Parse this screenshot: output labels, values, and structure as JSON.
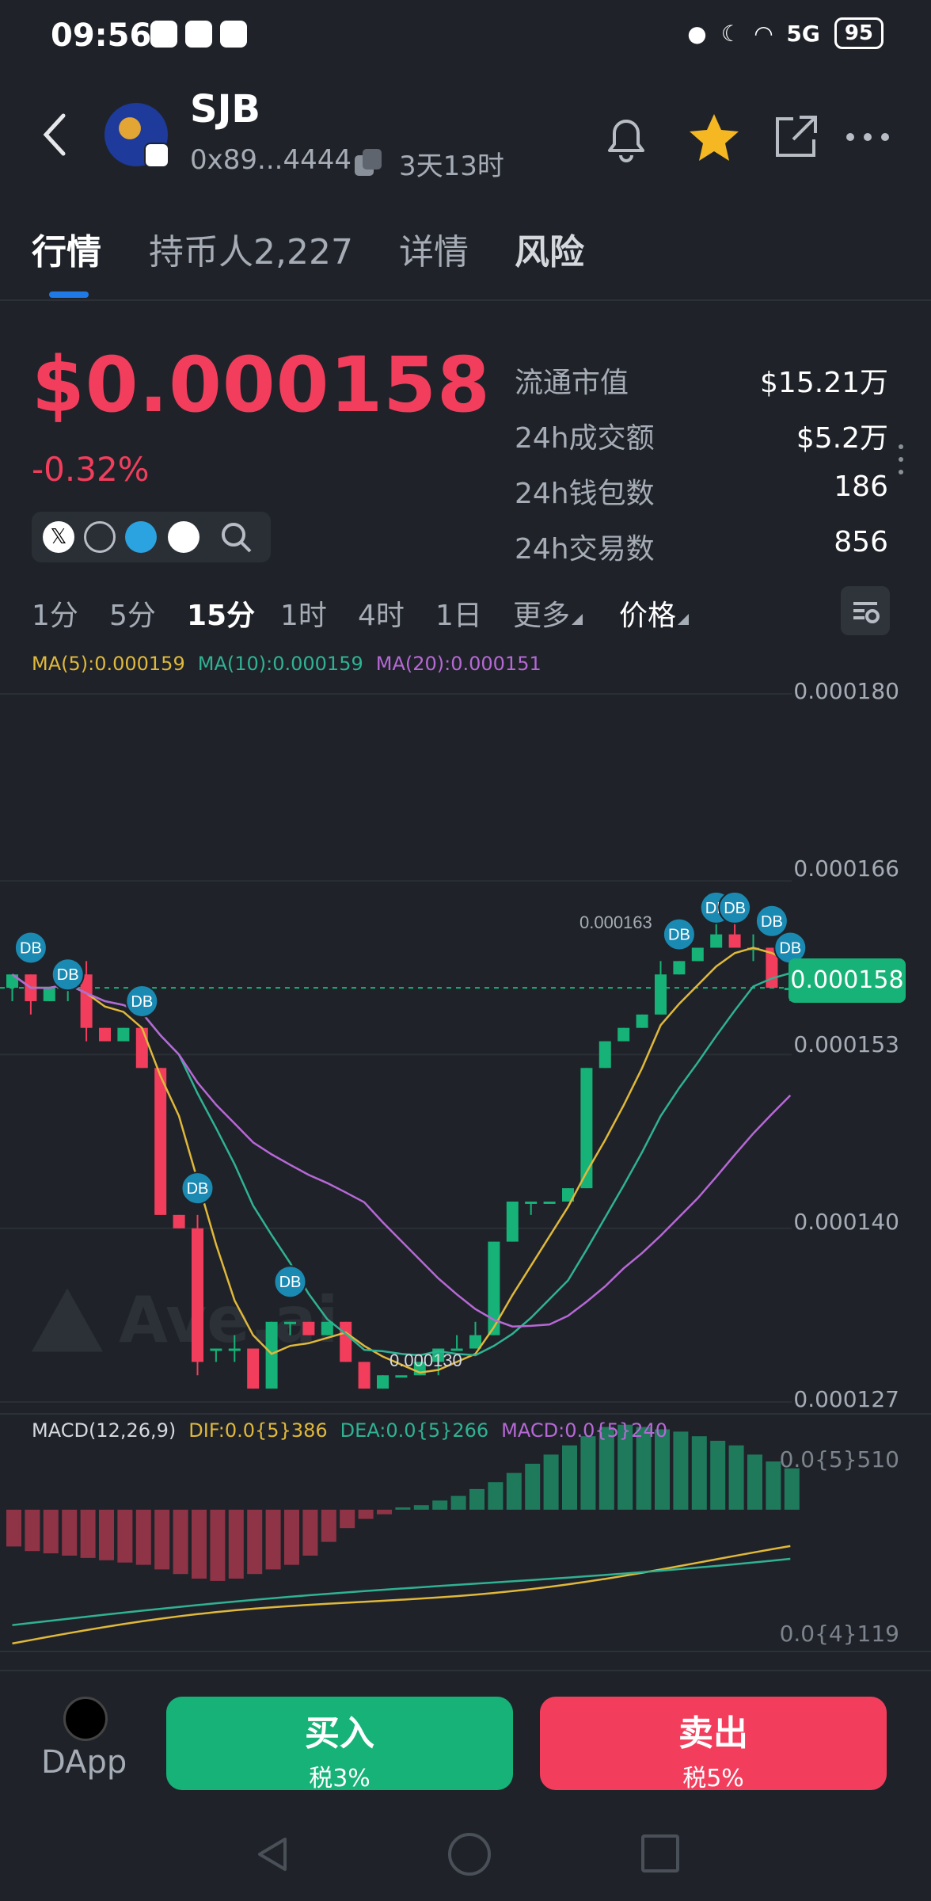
{
  "status_bar": {
    "time": "09:56",
    "network": "5G",
    "battery": "95"
  },
  "header": {
    "token_name": "SJB",
    "address": "0x89...4444",
    "age": "3天13时",
    "icons": [
      "back-icon",
      "copy-icon",
      "bell-icon",
      "star-icon",
      "share-icon",
      "more-icon"
    ]
  },
  "tabs": [
    "行情",
    "持币人2,227",
    "详情",
    "风险"
  ],
  "price": {
    "value": "$0.000158",
    "change": "-0.32%"
  },
  "stats": [
    {
      "label": "流通市值",
      "value": "$15.21万"
    },
    {
      "label": "24h成交额",
      "value": "$5.2万"
    },
    {
      "label": "24h钱包数",
      "value": "186"
    },
    {
      "label": "24h交易数",
      "value": "856"
    }
  ],
  "timeframes": [
    "1分",
    "5分",
    "15分",
    "1时",
    "4时",
    "1日"
  ],
  "timeframe_active": "15分",
  "more_label": "更多",
  "price_label": "价格",
  "ma_legend": {
    "ma5": "MA(5):0.000159",
    "ma10": "MA(10):0.000159",
    "ma20": "MA(20):0.000151"
  },
  "macd_legend": {
    "title": "MACD(12,26,9)",
    "dif": "DIF:0.0{5}386",
    "dea": "DEA:0.0{5}266",
    "macd": "MACD:0.0{5}240"
  },
  "y_axis": [
    "0.000180",
    "0.000166",
    "0.000153",
    "0.000140",
    "0.000127"
  ],
  "macd_axis": [
    "0.0{5}510",
    "0.0{4}119"
  ],
  "current_price_tag": "0.000158",
  "low_label": "0.000130",
  "high_label": "0.000163",
  "marker_label": "DB",
  "watermark": "Ave.ai",
  "colors": {
    "up": "#17b277",
    "down": "#f23e5c",
    "ma5": "#e0b83a",
    "ma10": "#2fb293",
    "ma20": "#b768d6"
  },
  "bottom": {
    "dapp": "DApp",
    "buy": "买入",
    "buy_tax": "税3%",
    "sell": "卖出",
    "sell_tax": "税5%"
  },
  "chart_data": {
    "type": "candlestick",
    "ylim": [
      0.000127,
      0.00018
    ],
    "candles": [
      {
        "o": 0.000158,
        "h": 0.000159,
        "l": 0.000157,
        "c": 0.000159
      },
      {
        "o": 0.000159,
        "h": 0.000159,
        "l": 0.000156,
        "c": 0.000157
      },
      {
        "o": 0.000157,
        "h": 0.000158,
        "l": 0.000157,
        "c": 0.000158
      },
      {
        "o": 0.000158,
        "h": 0.00016,
        "l": 0.000157,
        "c": 0.000159
      },
      {
        "o": 0.000159,
        "h": 0.00016,
        "l": 0.000154,
        "c": 0.000155
      },
      {
        "o": 0.000155,
        "h": 0.000155,
        "l": 0.000154,
        "c": 0.000154
      },
      {
        "o": 0.000154,
        "h": 0.000155,
        "l": 0.000154,
        "c": 0.000155
      },
      {
        "o": 0.000155,
        "h": 0.000155,
        "l": 0.000152,
        "c": 0.000152
      },
      {
        "o": 0.000152,
        "h": 0.000152,
        "l": 0.000141,
        "c": 0.000141
      },
      {
        "o": 0.000141,
        "h": 0.000141,
        "l": 0.00014,
        "c": 0.00014
      },
      {
        "o": 0.00014,
        "h": 0.000141,
        "l": 0.000129,
        "c": 0.00013
      },
      {
        "o": 0.000131,
        "h": 0.000131,
        "l": 0.00013,
        "c": 0.000131
      },
      {
        "o": 0.000131,
        "h": 0.000132,
        "l": 0.00013,
        "c": 0.000131
      },
      {
        "o": 0.000131,
        "h": 0.000131,
        "l": 0.000128,
        "c": 0.000128
      },
      {
        "o": 0.000128,
        "h": 0.000133,
        "l": 0.000128,
        "c": 0.000133
      },
      {
        "o": 0.000133,
        "h": 0.000133,
        "l": 0.000132,
        "c": 0.000133
      },
      {
        "o": 0.000133,
        "h": 0.000133,
        "l": 0.000132,
        "c": 0.000132
      },
      {
        "o": 0.000132,
        "h": 0.000133,
        "l": 0.000132,
        "c": 0.000133
      },
      {
        "o": 0.000133,
        "h": 0.000133,
        "l": 0.00013,
        "c": 0.00013
      },
      {
        "o": 0.00013,
        "h": 0.00013,
        "l": 0.000128,
        "c": 0.000128
      },
      {
        "o": 0.000128,
        "h": 0.000129,
        "l": 0.000128,
        "c": 0.000129
      },
      {
        "o": 0.000129,
        "h": 0.000129,
        "l": 0.000129,
        "c": 0.000129
      },
      {
        "o": 0.000129,
        "h": 0.00013,
        "l": 0.000129,
        "c": 0.00013
      },
      {
        "o": 0.00013,
        "h": 0.000131,
        "l": 0.000129,
        "c": 0.000131
      },
      {
        "o": 0.000131,
        "h": 0.000132,
        "l": 0.000131,
        "c": 0.000131
      },
      {
        "o": 0.000131,
        "h": 0.000133,
        "l": 0.000131,
        "c": 0.000132
      },
      {
        "o": 0.000132,
        "h": 0.000139,
        "l": 0.000132,
        "c": 0.000139
      },
      {
        "o": 0.000139,
        "h": 0.000142,
        "l": 0.000139,
        "c": 0.000142
      },
      {
        "o": 0.000142,
        "h": 0.000142,
        "l": 0.000141,
        "c": 0.000142
      },
      {
        "o": 0.000142,
        "h": 0.000142,
        "l": 0.000142,
        "c": 0.000142
      },
      {
        "o": 0.000142,
        "h": 0.000143,
        "l": 0.000142,
        "c": 0.000143
      },
      {
        "o": 0.000143,
        "h": 0.000152,
        "l": 0.000143,
        "c": 0.000152
      },
      {
        "o": 0.000152,
        "h": 0.000154,
        "l": 0.000152,
        "c": 0.000154
      },
      {
        "o": 0.000154,
        "h": 0.000155,
        "l": 0.000154,
        "c": 0.000155
      },
      {
        "o": 0.000155,
        "h": 0.000156,
        "l": 0.000155,
        "c": 0.000156
      },
      {
        "o": 0.000156,
        "h": 0.00016,
        "l": 0.000156,
        "c": 0.000159
      },
      {
        "o": 0.000159,
        "h": 0.00016,
        "l": 0.000159,
        "c": 0.00016
      },
      {
        "o": 0.00016,
        "h": 0.000161,
        "l": 0.00016,
        "c": 0.000161
      },
      {
        "o": 0.000161,
        "h": 0.000163,
        "l": 0.000161,
        "c": 0.000162
      },
      {
        "o": 0.000162,
        "h": 0.000163,
        "l": 0.000161,
        "c": 0.000161
      },
      {
        "o": 0.000161,
        "h": 0.000162,
        "l": 0.00016,
        "c": 0.000161
      },
      {
        "o": 0.000161,
        "h": 0.000161,
        "l": 0.000158,
        "c": 0.000158
      },
      {
        "o": 0.000158,
        "h": 0.000159,
        "l": 0.000157,
        "c": 0.000158
      }
    ],
    "macd_hist": [
      -0.8,
      -0.9,
      -0.95,
      -1.0,
      -1.05,
      -1.1,
      -1.15,
      -1.2,
      -1.3,
      -1.4,
      -1.5,
      -1.55,
      -1.5,
      -1.4,
      -1.3,
      -1.2,
      -1.0,
      -0.7,
      -0.4,
      -0.2,
      -0.1,
      0.05,
      0.1,
      0.2,
      0.3,
      0.45,
      0.6,
      0.8,
      1.0,
      1.2,
      1.4,
      1.6,
      1.8,
      1.85,
      1.8,
      1.75,
      1.7,
      1.6,
      1.5,
      1.4,
      1.2,
      1.05,
      0.9
    ]
  }
}
